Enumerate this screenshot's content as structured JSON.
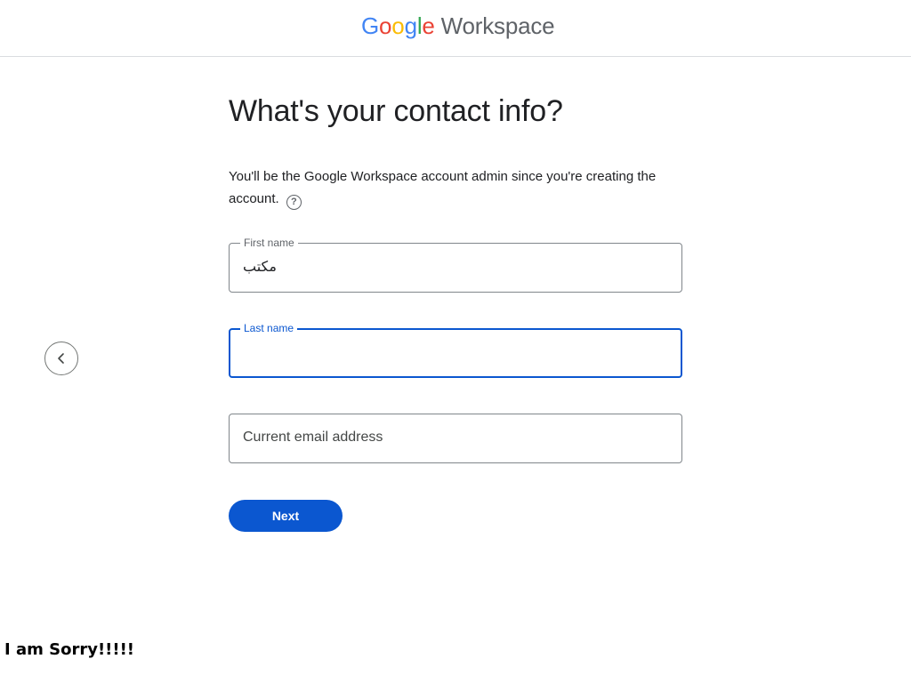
{
  "header": {
    "logo": {
      "letters": [
        "G",
        "o",
        "o",
        "g",
        "l",
        "e"
      ],
      "product": "Workspace"
    }
  },
  "main": {
    "title": "What's your contact info?",
    "description": "You'll be the Google Workspace account admin since you're creating the account.",
    "help_icon_glyph": "?",
    "fields": {
      "first_name": {
        "label": "First name",
        "value": "مكتب"
      },
      "last_name": {
        "label": "Last name",
        "value": ""
      },
      "email": {
        "placeholder": "Current email address",
        "value": ""
      }
    },
    "next_button": "Next"
  },
  "overlay_text": "I am Sorry!!!!!",
  "colors": {
    "accent": "#0b57d0",
    "border": "#80868b",
    "divider": "#dadce0"
  },
  "icons": {
    "back": "chevron-left-icon",
    "help": "help-circle-icon"
  }
}
